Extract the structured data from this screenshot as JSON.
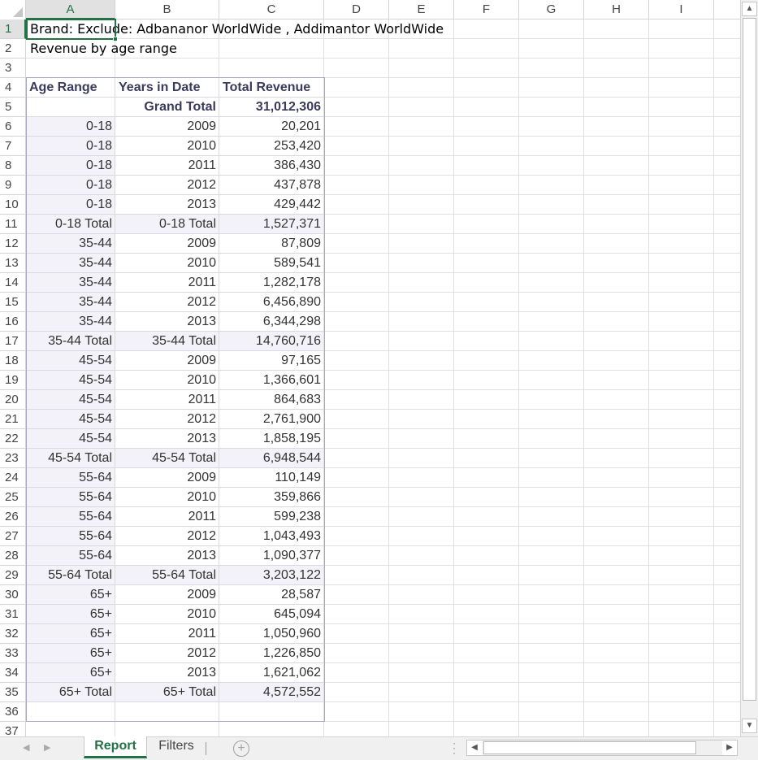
{
  "sheet": {
    "columns": [
      "A",
      "B",
      "C",
      "D",
      "E",
      "F",
      "G",
      "H",
      "I"
    ],
    "rows": [
      "1",
      "2",
      "3",
      "4",
      "5",
      "6",
      "7",
      "8",
      "9",
      "10",
      "11",
      "12",
      "13",
      "14",
      "15",
      "16",
      "17",
      "18",
      "19",
      "20",
      "21",
      "22",
      "23",
      "24",
      "25",
      "26",
      "27",
      "28",
      "29",
      "30",
      "31",
      "32",
      "33",
      "34",
      "35",
      "36",
      "37"
    ],
    "selected_cell": "A1",
    "cell_A1": "Brand: Exclude: Adbananor WorldWide , Addimantor WorldWide",
    "cell_A2": "Revenue by age range"
  },
  "pivot": {
    "headers": [
      "Age Range",
      "Years in Date",
      "Total Revenue"
    ],
    "grand_total_label": "Grand Total",
    "grand_total_value": "31,012,306",
    "rows": [
      {
        "a": "0-18",
        "b": "2009",
        "c": "20,201"
      },
      {
        "a": "0-18",
        "b": "2010",
        "c": "253,420"
      },
      {
        "a": "0-18",
        "b": "2011",
        "c": "386,430"
      },
      {
        "a": "0-18",
        "b": "2012",
        "c": "437,878"
      },
      {
        "a": "0-18",
        "b": "2013",
        "c": "429,442"
      },
      {
        "a": "0-18 Total",
        "b": "0-18 Total",
        "c": "1,527,371",
        "total": true
      },
      {
        "a": "35-44",
        "b": "2009",
        "c": "87,809"
      },
      {
        "a": "35-44",
        "b": "2010",
        "c": "589,541"
      },
      {
        "a": "35-44",
        "b": "2011",
        "c": "1,282,178"
      },
      {
        "a": "35-44",
        "b": "2012",
        "c": "6,456,890"
      },
      {
        "a": "35-44",
        "b": "2013",
        "c": "6,344,298"
      },
      {
        "a": "35-44 Total",
        "b": "35-44 Total",
        "c": "14,760,716",
        "total": true
      },
      {
        "a": "45-54",
        "b": "2009",
        "c": "97,165"
      },
      {
        "a": "45-54",
        "b": "2010",
        "c": "1,366,601"
      },
      {
        "a": "45-54",
        "b": "2011",
        "c": "864,683"
      },
      {
        "a": "45-54",
        "b": "2012",
        "c": "2,761,900"
      },
      {
        "a": "45-54",
        "b": "2013",
        "c": "1,858,195"
      },
      {
        "a": "45-54 Total",
        "b": "45-54 Total",
        "c": "6,948,544",
        "total": true
      },
      {
        "a": "55-64",
        "b": "2009",
        "c": "110,149"
      },
      {
        "a": "55-64",
        "b": "2010",
        "c": "359,866"
      },
      {
        "a": "55-64",
        "b": "2011",
        "c": "599,238"
      },
      {
        "a": "55-64",
        "b": "2012",
        "c": "1,043,493"
      },
      {
        "a": "55-64",
        "b": "2013",
        "c": "1,090,377"
      },
      {
        "a": "55-64 Total",
        "b": "55-64 Total",
        "c": "3,203,122",
        "total": true
      },
      {
        "a": "65+",
        "b": "2009",
        "c": "28,587"
      },
      {
        "a": "65+",
        "b": "2010",
        "c": "645,094"
      },
      {
        "a": "65+",
        "b": "2011",
        "c": "1,050,960"
      },
      {
        "a": "65+",
        "b": "2012",
        "c": "1,226,850"
      },
      {
        "a": "65+",
        "b": "2013",
        "c": "1,621,062"
      },
      {
        "a": "65+ Total",
        "b": "65+ Total",
        "c": "4,572,552",
        "total": true
      }
    ]
  },
  "tabs": [
    {
      "label": "Report",
      "active": true
    },
    {
      "label": "Filters",
      "active": false
    }
  ],
  "icons": {
    "prev_sheet": "chevron-left-icon",
    "next_sheet": "chevron-right-icon",
    "add_sheet": "plus-circle-icon",
    "scroll_up": "triangle-up-icon",
    "scroll_down": "triangle-down-icon",
    "scroll_left": "triangle-left-icon",
    "scroll_right": "triangle-right-icon"
  },
  "colors": {
    "accent": "#217346",
    "pivot_header_text": "#3a3a5a",
    "pivot_band": "#f2f2f8",
    "pivot_line": "#d9d9e3"
  }
}
